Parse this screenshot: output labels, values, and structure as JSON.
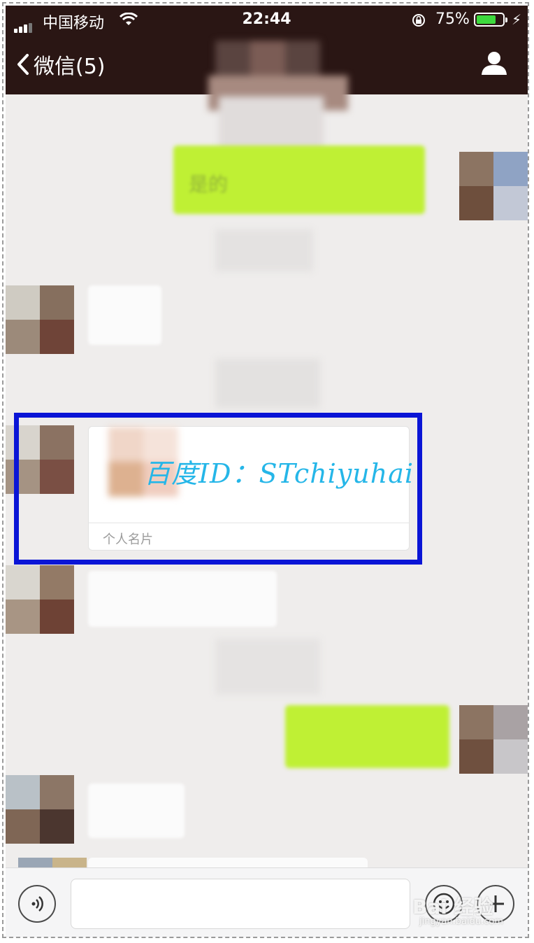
{
  "status_bar": {
    "carrier": "中国移动",
    "time": "22:44",
    "battery_percent": "75%",
    "battery_level": 0.75
  },
  "nav": {
    "back_label": "微信(5)"
  },
  "messages": {
    "sent_1_text": "是的"
  },
  "contact_card": {
    "type_label": "个人名片"
  },
  "watermark": {
    "id_text": "百度ID：STchiyuhai",
    "logo_text": "Bai 经验",
    "url": "jingyan.baidu.com"
  },
  "colors": {
    "nav_bg": "#2a1614",
    "highlight_border": "#0a15d6",
    "bubble_green": "#bff034",
    "watermark_text": "#25b6e8"
  }
}
